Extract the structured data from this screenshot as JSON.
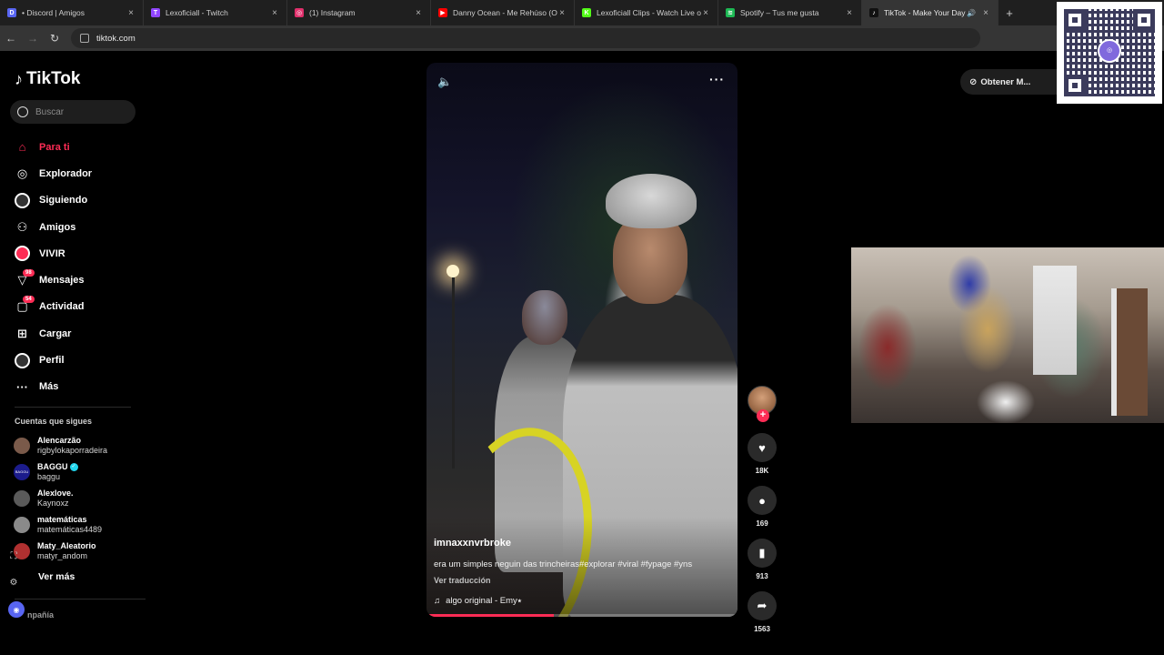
{
  "browser": {
    "tabs": [
      {
        "title": "• Discord | Amigos",
        "color": "#5865f2",
        "glyph": "D"
      },
      {
        "title": "Lexoficiall - Twitch",
        "color": "#9146ff",
        "glyph": "T"
      },
      {
        "title": "(1) Instagram",
        "color": "#e1306c",
        "glyph": "◎"
      },
      {
        "title": "Danny Ocean - Me Rehúso (Offic",
        "color": "#ff0000",
        "glyph": "▶"
      },
      {
        "title": "Lexoficiall Clips - Watch Live on",
        "color": "#53fc18",
        "glyph": "K"
      },
      {
        "title": "Spotify – Tus me gusta",
        "color": "#1db954",
        "glyph": "≋"
      },
      {
        "title": "TikTok - Make Your Day",
        "color": "#111111",
        "glyph": "♪",
        "active": true
      }
    ],
    "url": "tiktok.com"
  },
  "sidebar": {
    "logo": "TikTok",
    "search_placeholder": "Buscar",
    "menu": [
      {
        "label": "Para ti",
        "icon": "home-icon",
        "active": true
      },
      {
        "label": "Explorador",
        "icon": "compass-icon"
      },
      {
        "label": "Siguiendo",
        "icon": "following-avatar-icon"
      },
      {
        "label": "Amigos",
        "icon": "friends-icon"
      },
      {
        "label": "VIVIR",
        "icon": "live-icon"
      },
      {
        "label": "Mensajes",
        "icon": "messages-icon",
        "badge": "98"
      },
      {
        "label": "Actividad",
        "icon": "activity-icon",
        "badge": "54"
      },
      {
        "label": "Cargar",
        "icon": "upload-icon"
      },
      {
        "label": "Perfil",
        "icon": "profile-avatar-icon"
      },
      {
        "label": "Más",
        "icon": "more-icon"
      }
    ],
    "following_title": "Cuentas que sigues",
    "following": [
      {
        "name": "Alencarzão",
        "handle": "rigbylokaporradeira"
      },
      {
        "name": "BAGGU",
        "handle": "baggu",
        "verified": true,
        "avatar_text": "BAGGU"
      },
      {
        "name": "Alexlove.",
        "handle": "Kaynoxz"
      },
      {
        "name": "matemáticas",
        "handle": "matemáticas4489"
      },
      {
        "name": "Maty_Aleatorio",
        "handle": "matyr_andom"
      }
    ],
    "see_more": "Ver más",
    "company": "npañía"
  },
  "video": {
    "username": "imnaxxnvrbroke",
    "caption": "era um simples neguin das trincheiras#explorar #viral #fypage #yns",
    "translate": "Ver traducción",
    "sound": "algo original - Emy⭑",
    "progress": 0.41
  },
  "actions": {
    "likes": "18K",
    "comments": "169",
    "saves": "913",
    "shares": "1563"
  },
  "topright": {
    "get_app": "Obtener M..."
  }
}
